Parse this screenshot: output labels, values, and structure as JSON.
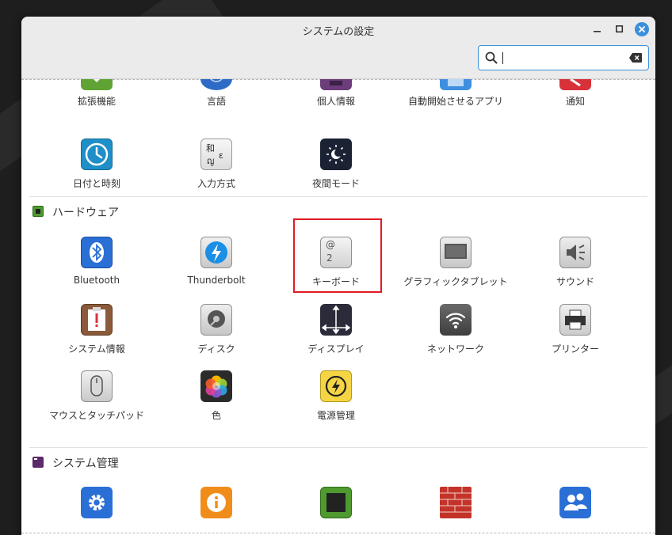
{
  "window": {
    "title": "システムの設定"
  },
  "search": {
    "value": "",
    "placeholder": ""
  },
  "colors": {
    "accent": "#3b8fdb",
    "highlight": "#e01b24"
  },
  "sections": {
    "personal_partial": {
      "items": [
        {
          "label": "拡張機能",
          "icon": "extensions-icon"
        },
        {
          "label": "言語",
          "icon": "language-icon"
        },
        {
          "label": "個人情報",
          "icon": "account-details-icon"
        },
        {
          "label": "自動開始させるアプリ",
          "icon": "startup-apps-icon"
        },
        {
          "label": "通知",
          "icon": "notifications-icon"
        },
        {
          "label": "日付と時刻",
          "icon": "clock-icon"
        },
        {
          "label": "入力方式",
          "icon": "input-method-icon"
        },
        {
          "label": "夜間モード",
          "icon": "night-mode-icon"
        }
      ]
    },
    "hardware": {
      "title": "ハードウェア",
      "items": [
        {
          "label": "Bluetooth",
          "icon": "bluetooth-icon"
        },
        {
          "label": "Thunderbolt",
          "icon": "thunderbolt-icon"
        },
        {
          "label": "キーボード",
          "icon": "keyboard-icon",
          "glyph_top": "@",
          "glyph_bottom": "2"
        },
        {
          "label": "グラフィックタブレット",
          "icon": "graphics-tablet-icon"
        },
        {
          "label": "サウンド",
          "icon": "sound-icon"
        },
        {
          "label": "システム情報",
          "icon": "system-info-icon"
        },
        {
          "label": "ディスク",
          "icon": "disk-icon"
        },
        {
          "label": "ディスプレイ",
          "icon": "display-icon"
        },
        {
          "label": "ネットワーク",
          "icon": "network-icon"
        },
        {
          "label": "プリンター",
          "icon": "printer-icon"
        },
        {
          "label": "マウスとタッチパッド",
          "icon": "mouse-icon"
        },
        {
          "label": "色",
          "icon": "color-icon"
        },
        {
          "label": "電源管理",
          "icon": "power-icon"
        }
      ]
    },
    "administration": {
      "title": "システム管理",
      "items": [
        {
          "icon": "settings-icon"
        },
        {
          "icon": "info-icon"
        },
        {
          "icon": "chip-icon"
        },
        {
          "icon": "firewall-icon"
        },
        {
          "icon": "users-icon"
        }
      ]
    }
  },
  "input_method_glyphs": {
    "a": "和",
    "b": "ญ",
    "c": "ε"
  }
}
